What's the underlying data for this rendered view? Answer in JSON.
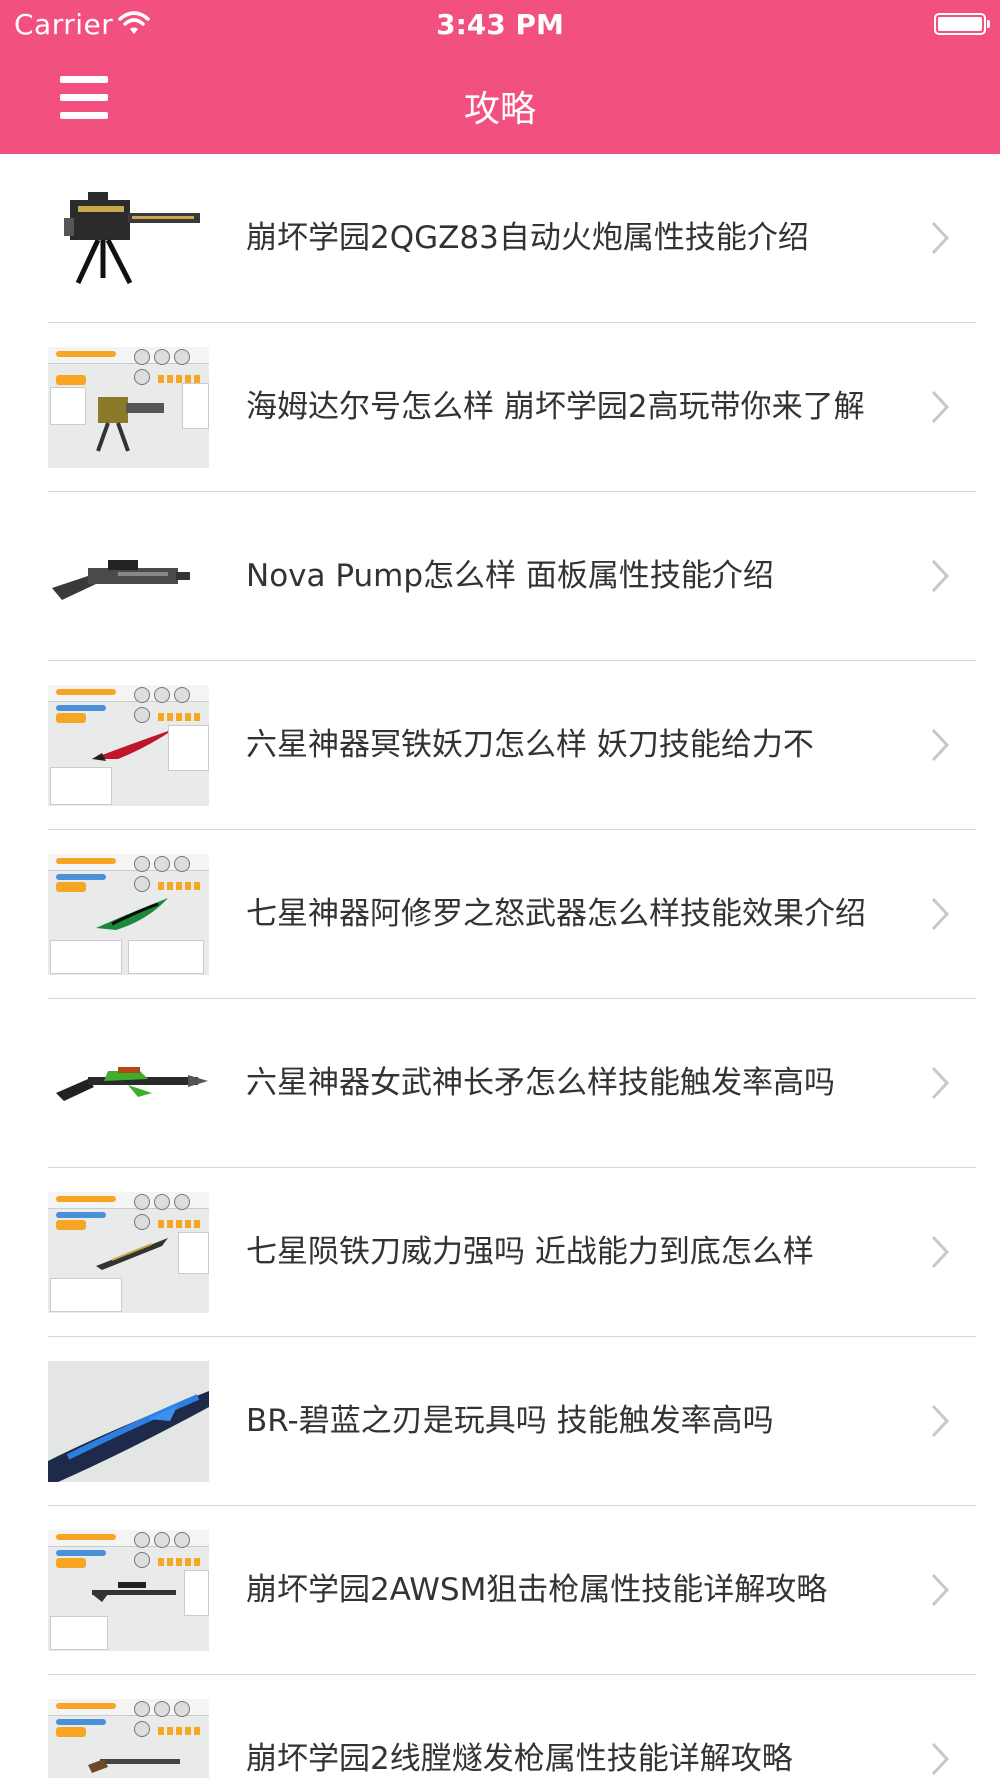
{
  "status_bar": {
    "carrier": "Carrier",
    "time": "3:43 PM"
  },
  "nav": {
    "title": "攻略",
    "menu_icon": "hamburger-menu-icon"
  },
  "colors": {
    "accent": "#f2517f",
    "separator": "#d6d6d6",
    "text": "#333333"
  },
  "articles": [
    {
      "title": "崩坏学园2QGZ83自动火炮属性技能介绍",
      "thumb": "turret-gun-image"
    },
    {
      "title": "海姆达尔号怎么样 崩坏学园2高玩带你来了解",
      "thumb": "turret-stats-screenshot"
    },
    {
      "title": "Nova Pump怎么样 面板属性技能介绍",
      "thumb": "shotgun-image"
    },
    {
      "title": "六星神器冥铁妖刀怎么样 妖刀技能给力不",
      "thumb": "red-blade-screenshot"
    },
    {
      "title": "七星神器阿修罗之怒武器怎么样技能效果介绍",
      "thumb": "green-blade-screenshot"
    },
    {
      "title": "六星神器女武神长矛怎么样技能触发率高吗",
      "thumb": "green-spear-image"
    },
    {
      "title": "七星陨铁刀威力强吗 近战能力到底怎么样",
      "thumb": "meteor-blade-screenshot"
    },
    {
      "title": "BR-碧蓝之刃是玩具吗 技能触发率高吗",
      "thumb": "blue-blade-image"
    },
    {
      "title": "崩坏学园2AWSM狙击枪属性技能详解攻略",
      "thumb": "sniper-screenshot"
    },
    {
      "title": "崩坏学园2线膛燧发枪属性技能详解攻略",
      "thumb": "rifle-screenshot"
    }
  ]
}
